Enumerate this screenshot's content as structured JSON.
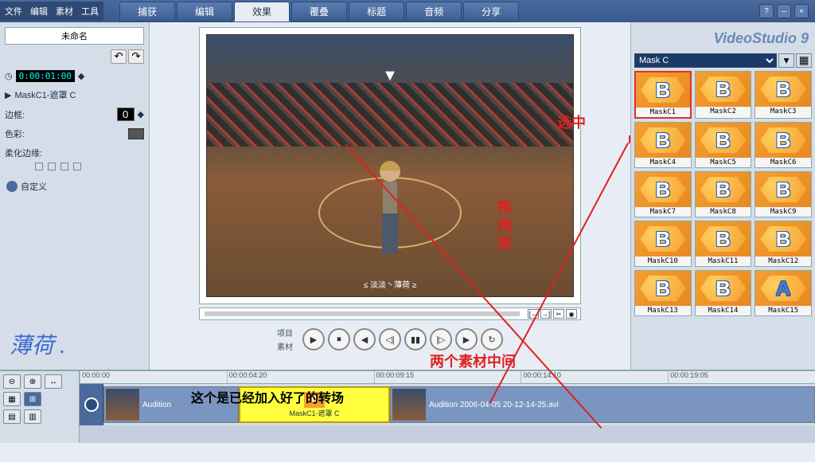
{
  "menu": {
    "file": "文件",
    "edit": "编辑",
    "clip": "素材",
    "tools": "工具"
  },
  "tabs": [
    "捕获",
    "编辑",
    "效果",
    "覆叠",
    "标题",
    "音频",
    "分享"
  ],
  "activeTab": 2,
  "winbtns": {
    "help": "?",
    "min": "–",
    "close": "×"
  },
  "sidebar": {
    "projectName": "未命名",
    "undo": "↶",
    "redo": "↷",
    "timecodeIcon": "◷",
    "timecode": "0:00:01:00",
    "timecodeStep": "◆",
    "effectIcon": "▶",
    "effectName": "MaskC1-遮罩 C",
    "borderLabel": "边框:",
    "borderVal": "0",
    "colorLabel": "色彩:",
    "softLabel": "柔化边缘:",
    "customize": "自定义",
    "watermark": "薄荷 ."
  },
  "preview": {
    "caption": "≤ 淡淡丶薄荷 ≥",
    "arrowDn": "▼",
    "projTab": "项目",
    "clipTab": "素材",
    "transport": [
      "▶",
      "⏹",
      "◀",
      "◁|",
      "▮▮",
      "|▷",
      "▶",
      "↻"
    ],
    "trimBtns": [
      "[←",
      "→]",
      "✂",
      "◉"
    ]
  },
  "brand": "VideoStudio 9",
  "library": {
    "category": "Mask C",
    "dropdown": "▾",
    "folderBtn": "▦",
    "items": [
      {
        "l": "MaskC1",
        "t": "B",
        "sel": true
      },
      {
        "l": "MaskC2",
        "t": "B"
      },
      {
        "l": "MaskC3",
        "t": "B"
      },
      {
        "l": "MaskC4",
        "t": "B"
      },
      {
        "l": "MaskC5",
        "t": "B"
      },
      {
        "l": "MaskC6",
        "t": "B"
      },
      {
        "l": "MaskC7",
        "t": "B"
      },
      {
        "l": "MaskC8",
        "t": "B"
      },
      {
        "l": "MaskC9",
        "t": "B"
      },
      {
        "l": "MaskC10",
        "t": "B"
      },
      {
        "l": "MaskC11",
        "t": "B"
      },
      {
        "l": "MaskC12",
        "t": "B"
      },
      {
        "l": "MaskC13",
        "t": "B"
      },
      {
        "l": "MaskC14",
        "t": "B"
      },
      {
        "l": "MaskC15",
        "t": "A"
      }
    ]
  },
  "timeline": {
    "tools": {
      "zoomOut": "⊖",
      "zoomIn": "⊕",
      "fit": "↔",
      "storyboard": "▦",
      "timeline": "⊞"
    },
    "ruler": [
      "00:00:00",
      "00:00:04:20",
      "00:00:09:15",
      "00:00:14:10",
      "00:00:19:05"
    ],
    "clip1": "Audition",
    "trans": "MaskC1-遮罩 C",
    "transB": "B",
    "clip2": "Audition 2006-04-05 20-12-14-25.avi"
  },
  "annotations": {
    "selected": "选中",
    "dragTo": "拖 拽 到",
    "between": "两个素材中间",
    "added": "这个是已经加入好了的转场"
  }
}
